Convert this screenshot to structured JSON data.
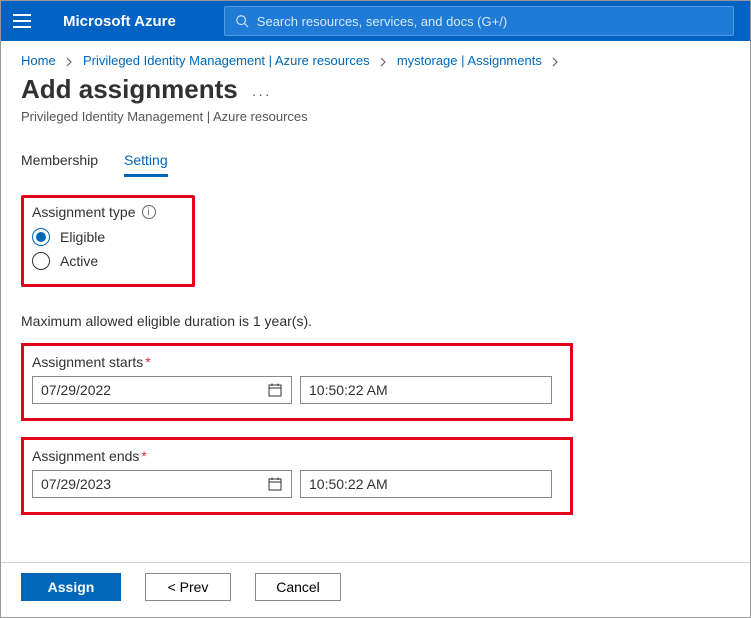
{
  "header": {
    "brand": "Microsoft Azure",
    "search_placeholder": "Search resources, services, and docs (G+/)"
  },
  "breadcrumbs": {
    "items": [
      {
        "label": "Home"
      },
      {
        "label": "Privileged Identity Management | Azure resources"
      },
      {
        "label": "mystorage | Assignments"
      }
    ]
  },
  "page": {
    "title": "Add assignments",
    "subtitle": "Privileged Identity Management | Azure resources"
  },
  "tabs": {
    "membership": "Membership",
    "setting": "Setting"
  },
  "assignment_type": {
    "label": "Assignment type",
    "options": {
      "eligible": "Eligible",
      "active": "Active"
    },
    "selected": "eligible"
  },
  "duration_hint": "Maximum allowed eligible duration is 1 year(s).",
  "start": {
    "label": "Assignment starts",
    "date": "07/29/2022",
    "time": "10:50:22 AM"
  },
  "end": {
    "label": "Assignment ends",
    "date": "07/29/2023",
    "time": "10:50:22 AM"
  },
  "footer": {
    "assign": "Assign",
    "prev": "<  Prev",
    "cancel": "Cancel"
  }
}
